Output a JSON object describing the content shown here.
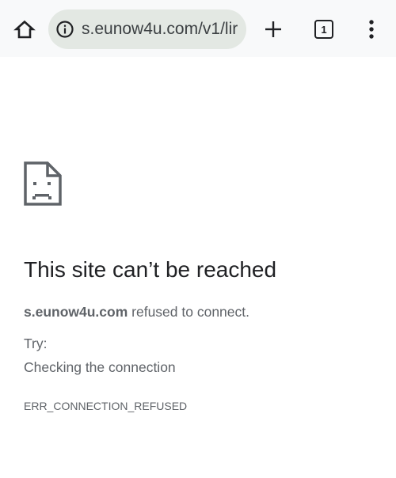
{
  "toolbar": {
    "url": "s.eunow4u.com/v1/lir",
    "tab_count": "1",
    "icons": {
      "home": "home-icon",
      "site_info": "info-icon",
      "new_tab": "plus-icon",
      "menu": "more-vertical-icon"
    }
  },
  "error_page": {
    "icon": "sad-page-icon",
    "title": "This site can’t be reached",
    "host": "s.eunow4u.com",
    "message_suffix": " refused to connect.",
    "try_label": "Try:",
    "suggestions": [
      "Checking the connection"
    ],
    "error_code": "ERR_CONNECTION_REFUSED"
  }
}
